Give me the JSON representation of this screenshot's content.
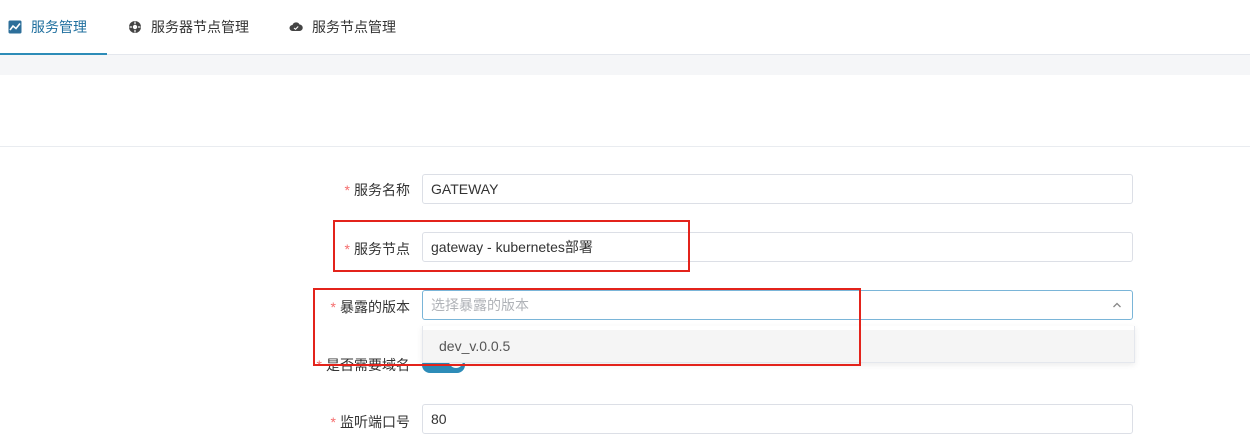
{
  "tabs": [
    {
      "label": "服务管理",
      "icon": "line-chart-icon",
      "active": true
    },
    {
      "label": "服务器节点管理",
      "icon": "cog-icon",
      "active": false
    },
    {
      "label": "服务节点管理",
      "icon": "cloud-icon",
      "active": false
    }
  ],
  "form": {
    "required_mark": "*",
    "service_name": {
      "label": "服务名称",
      "value": "GATEWAY"
    },
    "service_node": {
      "label": "服务节点",
      "value": "gateway - kubernetes部署"
    },
    "version": {
      "label": "暴露的版本",
      "placeholder": "选择暴露的版本",
      "options": [
        "dev_v.0.0.5"
      ]
    },
    "domain": {
      "label": "是否需要域名",
      "enabled": true
    },
    "port": {
      "label": "监听端口号",
      "value": "80"
    }
  },
  "colors": {
    "accent": "#2d8cb8",
    "highlight_box": "#e3231b",
    "required": "#f56c6c"
  }
}
